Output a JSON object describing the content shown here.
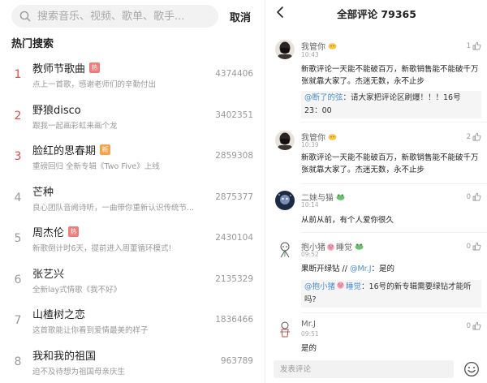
{
  "search": {
    "placeholder": "搜索音乐、视频、歌单、歌手...",
    "cancel_label": "取消"
  },
  "hot_search": {
    "title": "热门搜索",
    "items": [
      {
        "rank": "1",
        "title": "教师节歌曲",
        "badge": "热",
        "badge_type": "hot",
        "desc": "点上一首歌，感谢老师们的辛勤付出",
        "count": "4374406",
        "top": true
      },
      {
        "rank": "2",
        "title": "野狼disco",
        "badge": "",
        "badge_type": "",
        "desc": "跟我一起画彩虹来画个龙",
        "count": "3402351",
        "top": true
      },
      {
        "rank": "3",
        "title": "脸红的思春期",
        "badge": "新",
        "badge_type": "new",
        "desc": "重磅回归 全新专辑《Two Five》上线",
        "count": "2859308",
        "top": true
      },
      {
        "rank": "4",
        "title": "芒种",
        "badge": "",
        "badge_type": "",
        "desc": "良心团队音阙诗听，一曲带你重新认识传统节...",
        "count": "2875377",
        "top": false
      },
      {
        "rank": "5",
        "title": "周杰伦",
        "badge": "热",
        "badge_type": "hot",
        "desc": "新歌倒计时6天，提前进入周董循环模式!",
        "count": "2430104",
        "top": false
      },
      {
        "rank": "6",
        "title": "张艺兴",
        "badge": "",
        "badge_type": "",
        "desc": "全新lay式情歌《我不好》",
        "count": "2135329",
        "top": false
      },
      {
        "rank": "7",
        "title": "山楂树之恋",
        "badge": "",
        "badge_type": "",
        "desc": "这首歌能让你看到爱情最美的样子",
        "count": "1836466",
        "top": false
      },
      {
        "rank": "8",
        "title": "我和我的祖国",
        "badge": "",
        "badge_type": "",
        "desc": "迫不及待想为祖国母亲庆生",
        "count": "963789",
        "top": false
      }
    ]
  },
  "comments_page": {
    "title": "全部评论 79365",
    "input_placeholder": "发表评论",
    "comments": [
      {
        "name": "我管你",
        "time": "10:43",
        "likes": "1",
        "text": "新歌评论一天能不能破百万，新歌销售能不能破千万张就靠大家了。杰迷无数，永不止步",
        "reply_mention": "@断了的弦",
        "reply_text": "：请大家把评论区刷爆！！！16号23：00"
      },
      {
        "name": "我管你",
        "time": "10:39",
        "likes": "2",
        "text": "新歌评论一天能不能破百万，新歌销售能不能破千万张就靠大家了。杰迷无数，永不止步"
      },
      {
        "name": "二妹与猫",
        "time": "10:14",
        "likes": "0",
        "text": "从前从前，有个人爱你很久"
      },
      {
        "name": "抱小猪",
        "name_suffix": "睡觉",
        "time": "09:52",
        "likes": "0",
        "text_prefix": "果断开绿钻 //",
        "text_mention": "@Mr.J",
        "text_suffix": "：是的",
        "reply_mention": "@抱小猪睡觉",
        "reply_text": "：16号的新专辑需要绿钻才能听吗?"
      },
      {
        "name": "Mr.J",
        "time": "09:51",
        "likes": "0",
        "text": "是的"
      }
    ]
  },
  "colors": {
    "accent_red": "#e44c4c",
    "mention_blue": "#4a8ecc",
    "badge_hot": "#f07b7b",
    "badge_new": "#f5a24a"
  }
}
